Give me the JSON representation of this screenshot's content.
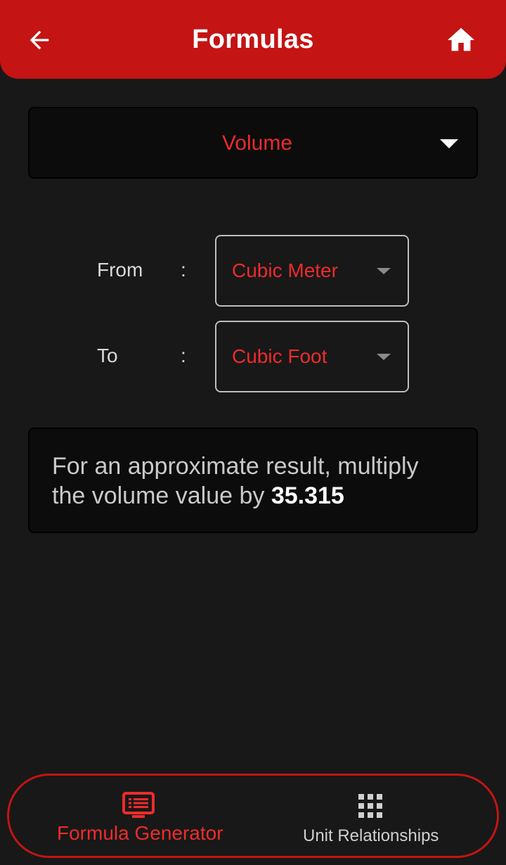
{
  "header": {
    "title": "Formulas",
    "back_icon": "arrow-left-icon",
    "home_icon": "home-icon"
  },
  "category": {
    "selected": "Volume",
    "icon": "caret-down-icon"
  },
  "conversion": {
    "from_label": "From",
    "to_label": "To",
    "separator": ":",
    "from_unit": "Cubic Meter",
    "to_unit": "Cubic Foot"
  },
  "result": {
    "text": "For an approximate result, multiply the volume value by ",
    "factor": "35.315"
  },
  "bottom_nav": {
    "items": [
      {
        "label": "Formula Generator",
        "icon": "list-box-icon",
        "active": true
      },
      {
        "label": "Unit Relationships",
        "icon": "grid-icon",
        "active": false
      }
    ]
  },
  "colors": {
    "accent": "#c41414",
    "accent_text": "#ee2b2b",
    "background": "#181818",
    "card": "#0c0c0c"
  }
}
